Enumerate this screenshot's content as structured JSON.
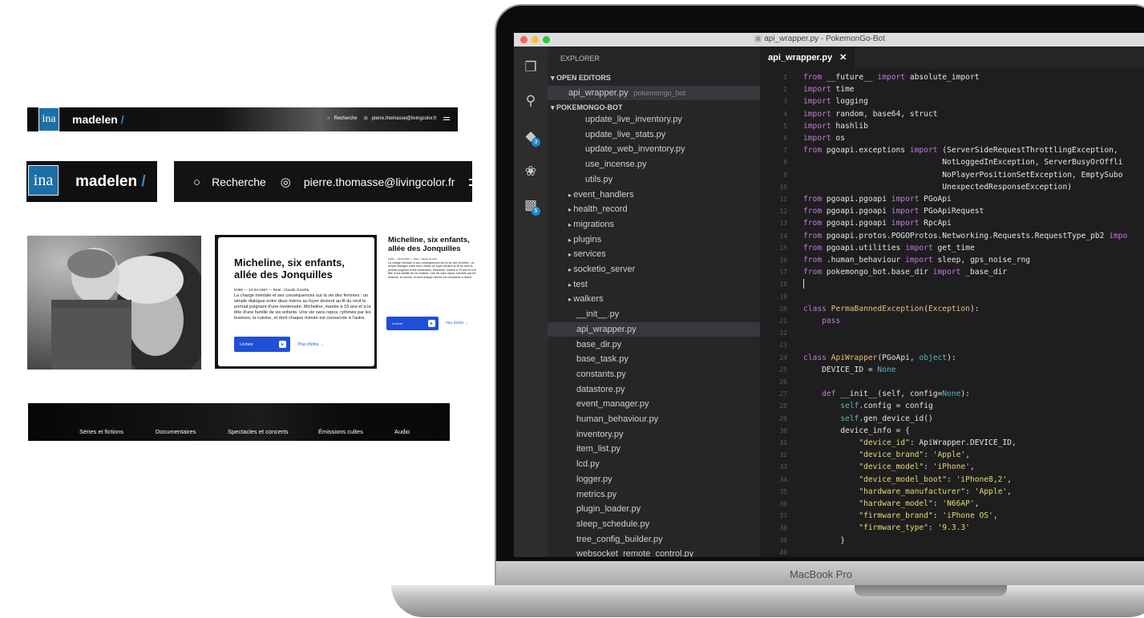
{
  "ina": {
    "logo_text": "ina",
    "brand": "madelen",
    "slash": "/",
    "search_label": "Recherche",
    "user_email": "pierre.thomasse@livingcolor.fr"
  },
  "card": {
    "title": "Micheline, six enfants, allée des Jonquilles",
    "meta": "0H55 — 24-04-1967 — Réal : Claude Goretta",
    "description": "La charge mentale et ses conséquences sur la vie des femmes : un simple dialogue entre deux mères au foyer devient au fil du récit le portrait poignant d'une trentenaire, Micheline, mariée à 19 ans et à la tête d'une famille de six enfants. Une vie sans repos, rythmée par les lessives, la cuisine, et dont chaque minute est consacrée à l'autre.",
    "play_label": "Lecture",
    "more_label": "Plus d'infos"
  },
  "nav": {
    "items": [
      "Séries et fictions",
      "Documentaires",
      "Spectacles et concerts",
      "Émissions cultes",
      "Audio"
    ]
  },
  "laptop": {
    "label": "MacBook Pro"
  },
  "vscode": {
    "window_title": "api_wrapper.py - PokemonGo-Bot",
    "explorer_label": "EXPLORER",
    "open_editors_label": "OPEN EDITORS",
    "open_file": "api_wrapper.py",
    "open_file_path": "pokemongo_bot",
    "project_label": "POKEMONGO-BOT",
    "badges": {
      "git": "3",
      "extensions": "5"
    },
    "tab_label": "api_wrapper.py",
    "files_nested": [
      "update_live_inventory.py",
      "update_live_stats.py",
      "update_web_inventory.py",
      "use_incense.py",
      "utils.py"
    ],
    "folders": [
      "event_handlers",
      "health_record",
      "migrations",
      "plugins",
      "services",
      "socketio_server",
      "test",
      "walkers"
    ],
    "files": [
      "__init__.py",
      "api_wrapper.py",
      "base_dir.py",
      "base_task.py",
      "constants.py",
      "datastore.py",
      "event_manager.py",
      "human_behaviour.py",
      "inventory.py",
      "item_list.py",
      "lcd.py",
      "logger.py",
      "metrics.py",
      "plugin_loader.py",
      "sleep_schedule.py",
      "tree_config_builder.py",
      "websocket_remote_control.py"
    ],
    "selected_file": "api_wrapper.py",
    "code_lines": [
      {
        "n": "1",
        "parts": [
          [
            "kw",
            "from"
          ],
          [
            "tx",
            " __future__ "
          ],
          [
            "kw",
            "import"
          ],
          [
            "tx",
            " absolute_import"
          ]
        ]
      },
      {
        "n": "2",
        "parts": [
          [
            "kw",
            "import"
          ],
          [
            "tx",
            " time"
          ]
        ]
      },
      {
        "n": "3",
        "parts": [
          [
            "kw",
            "import"
          ],
          [
            "tx",
            " logging"
          ]
        ]
      },
      {
        "n": "4",
        "parts": [
          [
            "kw",
            "import"
          ],
          [
            "tx",
            " random, base64, struct"
          ]
        ]
      },
      {
        "n": "5",
        "parts": [
          [
            "kw",
            "import"
          ],
          [
            "tx",
            " hashlib"
          ]
        ]
      },
      {
        "n": "6",
        "parts": [
          [
            "kw",
            "import"
          ],
          [
            "tx",
            " os"
          ]
        ]
      },
      {
        "n": "7",
        "parts": [
          [
            "kw",
            "from"
          ],
          [
            "tx",
            " pgoapi.exceptions "
          ],
          [
            "kw",
            "import"
          ],
          [
            "tx",
            " (ServerSideRequestThrottlingException,"
          ]
        ]
      },
      {
        "n": "8",
        "parts": [
          [
            "tx",
            "                              NotLoggedInException, ServerBusyOrOffli"
          ]
        ]
      },
      {
        "n": "9",
        "parts": [
          [
            "tx",
            "                              NoPlayerPositionSetException, EmptySubo"
          ]
        ]
      },
      {
        "n": "10",
        "parts": [
          [
            "tx",
            "                              UnexpectedResponseException)"
          ]
        ]
      },
      {
        "n": "11",
        "parts": [
          [
            "kw",
            "from"
          ],
          [
            "tx",
            " pgoapi.pgoapi "
          ],
          [
            "kw",
            "import"
          ],
          [
            "tx",
            " PGoApi"
          ]
        ]
      },
      {
        "n": "12",
        "parts": [
          [
            "kw",
            "from"
          ],
          [
            "tx",
            " pgoapi.pgoapi "
          ],
          [
            "kw",
            "import"
          ],
          [
            "tx",
            " PGoApiRequest"
          ]
        ]
      },
      {
        "n": "13",
        "parts": [
          [
            "kw",
            "from"
          ],
          [
            "tx",
            " pgoapi.pgoapi "
          ],
          [
            "kw",
            "import"
          ],
          [
            "tx",
            " RpcApi"
          ]
        ]
      },
      {
        "n": "14",
        "parts": [
          [
            "kw",
            "from"
          ],
          [
            "tx",
            " pgoapi.protos.POGOProtos.Networking.Requests.RequestType_pb2 "
          ],
          [
            "kw",
            "impo"
          ]
        ]
      },
      {
        "n": "15",
        "parts": [
          [
            "kw",
            "from"
          ],
          [
            "tx",
            " pgoapi.utilities "
          ],
          [
            "kw",
            "import"
          ],
          [
            "tx",
            " get_time"
          ]
        ]
      },
      {
        "n": "16",
        "parts": [
          [
            "kw",
            "from"
          ],
          [
            "tx",
            " .human_behaviour "
          ],
          [
            "kw",
            "import"
          ],
          [
            "tx",
            " sleep, gps_noise_rng"
          ]
        ]
      },
      {
        "n": "17",
        "parts": [
          [
            "kw",
            "from"
          ],
          [
            "tx",
            " pokemongo_bot.base_dir "
          ],
          [
            "kw",
            "import"
          ],
          [
            "tx",
            " _base_dir"
          ]
        ]
      },
      {
        "n": "18",
        "parts": [
          [
            "tx",
            ""
          ]
        ]
      },
      {
        "n": "19",
        "parts": [
          [
            "tx",
            ""
          ]
        ]
      },
      {
        "n": "20",
        "parts": [
          [
            "kw",
            "class"
          ],
          [
            "tx",
            " "
          ],
          [
            "cls",
            "PermaBannedException"
          ],
          [
            "tx",
            "("
          ],
          [
            "cls",
            "Exception"
          ],
          [
            "tx",
            "):"
          ]
        ]
      },
      {
        "n": "21",
        "parts": [
          [
            "kw",
            "    pass"
          ]
        ]
      },
      {
        "n": "22",
        "parts": [
          [
            "tx",
            ""
          ]
        ]
      },
      {
        "n": "23",
        "parts": [
          [
            "tx",
            ""
          ]
        ]
      },
      {
        "n": "24",
        "parts": [
          [
            "kw",
            "class"
          ],
          [
            "tx",
            " "
          ],
          [
            "cls",
            "ApiWrapper"
          ],
          [
            "tx",
            "(PGoApi, "
          ],
          [
            "none",
            "object"
          ],
          [
            "tx",
            "):"
          ]
        ]
      },
      {
        "n": "25",
        "parts": [
          [
            "tx",
            "    DEVICE_ID = "
          ],
          [
            "none",
            "None"
          ]
        ]
      },
      {
        "n": "26",
        "parts": [
          [
            "tx",
            ""
          ]
        ]
      },
      {
        "n": "27",
        "parts": [
          [
            "kw",
            "    def"
          ],
          [
            "tx",
            " __init__(self, config="
          ],
          [
            "none",
            "None"
          ],
          [
            "tx",
            "):"
          ]
        ]
      },
      {
        "n": "28",
        "parts": [
          [
            "tx",
            "        "
          ],
          [
            "none",
            "self"
          ],
          [
            "tx",
            ".config = config"
          ]
        ]
      },
      {
        "n": "29",
        "parts": [
          [
            "tx",
            "        "
          ],
          [
            "none",
            "self"
          ],
          [
            "tx",
            ".gen_device_id()"
          ]
        ]
      },
      {
        "n": "30",
        "parts": [
          [
            "tx",
            "        device_info = {"
          ]
        ]
      },
      {
        "n": "31",
        "parts": [
          [
            "tx",
            "            "
          ],
          [
            "str",
            "\"device_id\""
          ],
          [
            "tx",
            ": ApiWrapper.DEVICE_ID,"
          ]
        ]
      },
      {
        "n": "32",
        "parts": [
          [
            "tx",
            "            "
          ],
          [
            "str",
            "\"device_brand\""
          ],
          [
            "tx",
            ": "
          ],
          [
            "str",
            "'Apple'"
          ],
          [
            "tx",
            ","
          ]
        ]
      },
      {
        "n": "33",
        "parts": [
          [
            "tx",
            "            "
          ],
          [
            "str",
            "\"device_model\""
          ],
          [
            "tx",
            ": "
          ],
          [
            "str",
            "'iPhone'"
          ],
          [
            "tx",
            ","
          ]
        ]
      },
      {
        "n": "34",
        "parts": [
          [
            "tx",
            "            "
          ],
          [
            "str",
            "\"device_model_boot\""
          ],
          [
            "tx",
            ": "
          ],
          [
            "str",
            "'iPhone8,2'"
          ],
          [
            "tx",
            ","
          ]
        ]
      },
      {
        "n": "35",
        "parts": [
          [
            "tx",
            "            "
          ],
          [
            "str",
            "\"hardware_manufacturer\""
          ],
          [
            "tx",
            ": "
          ],
          [
            "str",
            "'Apple'"
          ],
          [
            "tx",
            ","
          ]
        ]
      },
      {
        "n": "36",
        "parts": [
          [
            "tx",
            "            "
          ],
          [
            "str",
            "\"hardware_model\""
          ],
          [
            "tx",
            ": "
          ],
          [
            "str",
            "'N66AP'"
          ],
          [
            "tx",
            ","
          ]
        ]
      },
      {
        "n": "37",
        "parts": [
          [
            "tx",
            "            "
          ],
          [
            "str",
            "\"firmware_brand\""
          ],
          [
            "tx",
            ": "
          ],
          [
            "str",
            "'iPhone OS'"
          ],
          [
            "tx",
            ","
          ]
        ]
      },
      {
        "n": "38",
        "parts": [
          [
            "tx",
            "            "
          ],
          [
            "str",
            "\"firmware_type\""
          ],
          [
            "tx",
            ": "
          ],
          [
            "str",
            "'9.3.3'"
          ]
        ]
      },
      {
        "n": "39",
        "parts": [
          [
            "tx",
            "        }"
          ]
        ]
      },
      {
        "n": "40",
        "parts": [
          [
            "tx",
            ""
          ]
        ]
      }
    ]
  },
  "colors": {
    "ina_blue": "#1d6fa8",
    "accent_blue": "#1f4fd8",
    "editor_bg": "#1e1e1e"
  }
}
